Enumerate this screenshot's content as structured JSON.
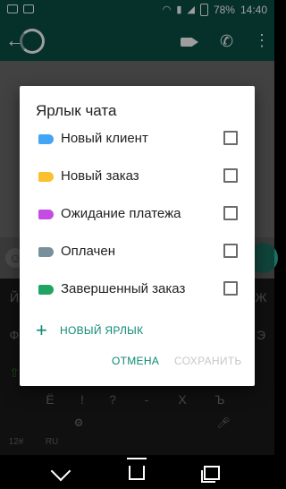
{
  "status_bar": {
    "battery": "78%",
    "time": "14:40"
  },
  "chat": {
    "title": ""
  },
  "keyboard": {
    "row1": [
      "Й",
      "",
      "",
      "",
      "",
      "",
      "",
      "",
      "",
      "",
      "",
      "Ж"
    ],
    "row2": [
      "Ф",
      "",
      "",
      "",
      "",
      "",
      "",
      "",
      "",
      "",
      "Э"
    ],
    "row3_left": "⇧",
    "symbols": [
      "Ё",
      "!",
      "?",
      "-",
      "Х",
      "Ъ"
    ],
    "bottom": [
      "12#",
      "RU",
      "",
      "",
      "",
      "",
      "",
      "",
      "",
      "",
      "",
      ""
    ]
  },
  "dialog": {
    "title": "Ярлык чата",
    "labels": [
      {
        "text": "Новый клиент",
        "color": "#42a5f5",
        "checked": false
      },
      {
        "text": "Новый заказ",
        "color": "#fbc02d",
        "checked": false
      },
      {
        "text": "Ожидание платежа",
        "color": "#c54ce3",
        "checked": false
      },
      {
        "text": "Оплачен",
        "color": "#78909c",
        "checked": false
      },
      {
        "text": "Завершенный заказ",
        "color": "#1fa463",
        "checked": false
      }
    ],
    "new_label": "НОВЫЙ ЯРЛЫК",
    "cancel": "ОТМЕНА",
    "save": "СОХРАНИТЬ"
  }
}
